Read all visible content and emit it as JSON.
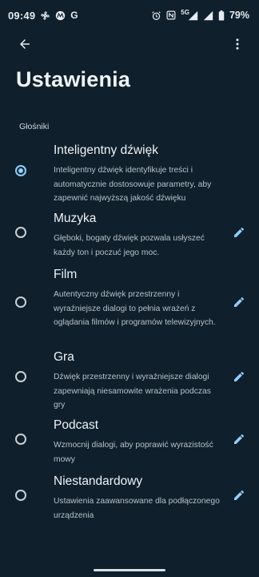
{
  "status_bar": {
    "time": "09:49",
    "left_icons": [
      "fan-icon",
      "motorola-icon",
      "google-icon"
    ],
    "right_icons": [
      "alarm-icon",
      "nfc-icon",
      "5g-signal-icon",
      "wifi-icon",
      "battery-icon"
    ],
    "network": "5G",
    "battery": "79%",
    "google_letter": "G"
  },
  "app_bar": {
    "back_icon": "arrow-back-icon",
    "more_icon": "more-vert-icon"
  },
  "page": {
    "title": "Ustawienia",
    "section_label": "Głośniki"
  },
  "options": [
    {
      "title": "Inteligentny dźwięk",
      "description": "Inteligentny dźwięk identyfikuje treści i automatycznie dostosowuje parametry, aby zapewnić najwyższą jakość dźwięku",
      "selected": true,
      "editable": false
    },
    {
      "title": "Muzyka",
      "description": "Głęboki, bogaty dźwięk pozwala usłyszeć każdy ton i poczuć jego moc.",
      "selected": false,
      "editable": true
    },
    {
      "title": "Film",
      "description": "Autentyczny dźwięk przestrzenny i wyraźniejsze dialogi to pełnia wrażeń z oglądania filmów i programów telewizyjnych.",
      "selected": false,
      "editable": true
    },
    {
      "title": "Gra",
      "description": "Dźwięk przestrzenny i wyraźniejsze dialogi zapewniają niesamowite wrażenia podczas gry",
      "selected": false,
      "editable": true
    },
    {
      "title": "Podcast",
      "description": "Wzmocnij dialogi, aby poprawić wyrazistość mowy",
      "selected": false,
      "editable": true
    },
    {
      "title": "Niestandardowy",
      "description": "Ustawienia zaawansowane dla podłączonego urządzenia",
      "selected": false,
      "editable": true
    }
  ],
  "colors": {
    "background": "#0f1f2b",
    "accent": "#8fd0ff",
    "edit_icon": "#8fd0ff"
  }
}
